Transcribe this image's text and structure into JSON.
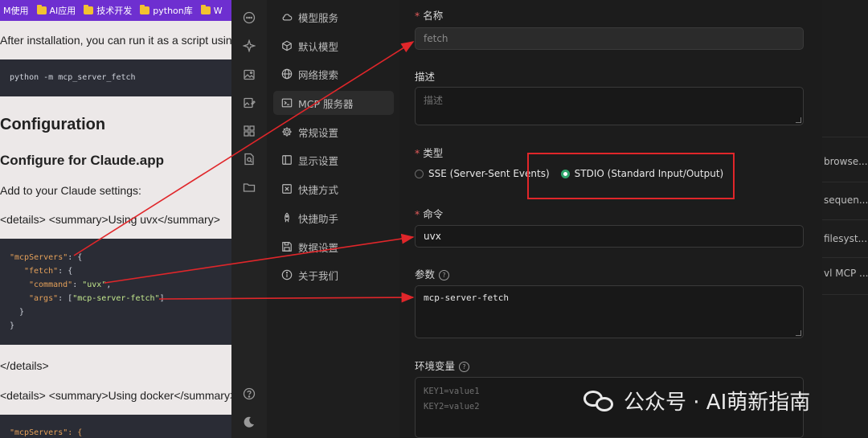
{
  "bookmarks": [
    {
      "label": "M使用"
    },
    {
      "label": "AI应用"
    },
    {
      "label": "技术开发"
    },
    {
      "label": "python库"
    },
    {
      "label": "W"
    }
  ],
  "doc": {
    "intro": "After installation, you can run it as a script using",
    "code1": "python -m mcp_server_fetch",
    "h_config": "Configuration",
    "h_claude": "Configure for Claude.app",
    "add_settings": "Add to your Claude settings:",
    "details_uvx": "<details> <summary>Using uvx</summary>",
    "code2": {
      "l1_key": "\"mcpServers\"",
      "l1_rest": ": {",
      "l2_key": "\"fetch\"",
      "l2_rest": ": {",
      "l3_key": "\"command\"",
      "l3_sep": ": ",
      "l3_val": "\"uvx\"",
      "l3_end": ",",
      "l4_key": "\"args\"",
      "l4_sep": ": [",
      "l4_val": "\"mcp-server-fetch\"",
      "l4_end": "]",
      "l5": "}",
      "l6": "}"
    },
    "details_close": "</details>",
    "details_docker": "<details> <summary>Using docker</summary>",
    "code3_l1": "\"mcpServers\": {"
  },
  "menu": [
    {
      "label": "模型服务",
      "icon": "cloud-icon",
      "active": false
    },
    {
      "label": "默认模型",
      "icon": "cube-icon",
      "active": false
    },
    {
      "label": "网络搜索",
      "icon": "globe-icon",
      "active": false
    },
    {
      "label": "MCP 服务器",
      "icon": "terminal-icon",
      "active": true
    },
    {
      "label": "常规设置",
      "icon": "gear-icon",
      "active": false
    },
    {
      "label": "显示设置",
      "icon": "display-icon",
      "active": false
    },
    {
      "label": "快捷方式",
      "icon": "command-icon",
      "active": false
    },
    {
      "label": "快捷助手",
      "icon": "rocket-icon",
      "active": false
    },
    {
      "label": "数据设置",
      "icon": "save-icon",
      "active": false
    },
    {
      "label": "关于我们",
      "icon": "info-icon",
      "active": false
    }
  ],
  "form": {
    "name_label": "名称",
    "name_value": "fetch",
    "desc_label": "描述",
    "desc_placeholder": "描述",
    "type_label": "类型",
    "type_sse": "SSE (Server-Sent Events)",
    "type_stdio": "STDIO (Standard Input/Output)",
    "cmd_label": "命令",
    "cmd_value": "uvx",
    "args_label": "参数",
    "args_value": "mcp-server-fetch",
    "env_label": "环境变量",
    "env_placeholder_1": "KEY1=value1",
    "env_placeholder_2": "KEY2=value2"
  },
  "right": [
    {
      "label": "browse..."
    },
    {
      "label": "sequen..."
    },
    {
      "label": "filesyst..."
    },
    {
      "label": "vl MCP ..."
    }
  ],
  "watermark": "公众号 · AI萌新指南",
  "colors": {
    "accent": "#2ea46b",
    "annotation": "#e0262a",
    "bookmark_bar": "#6e2fd0"
  }
}
